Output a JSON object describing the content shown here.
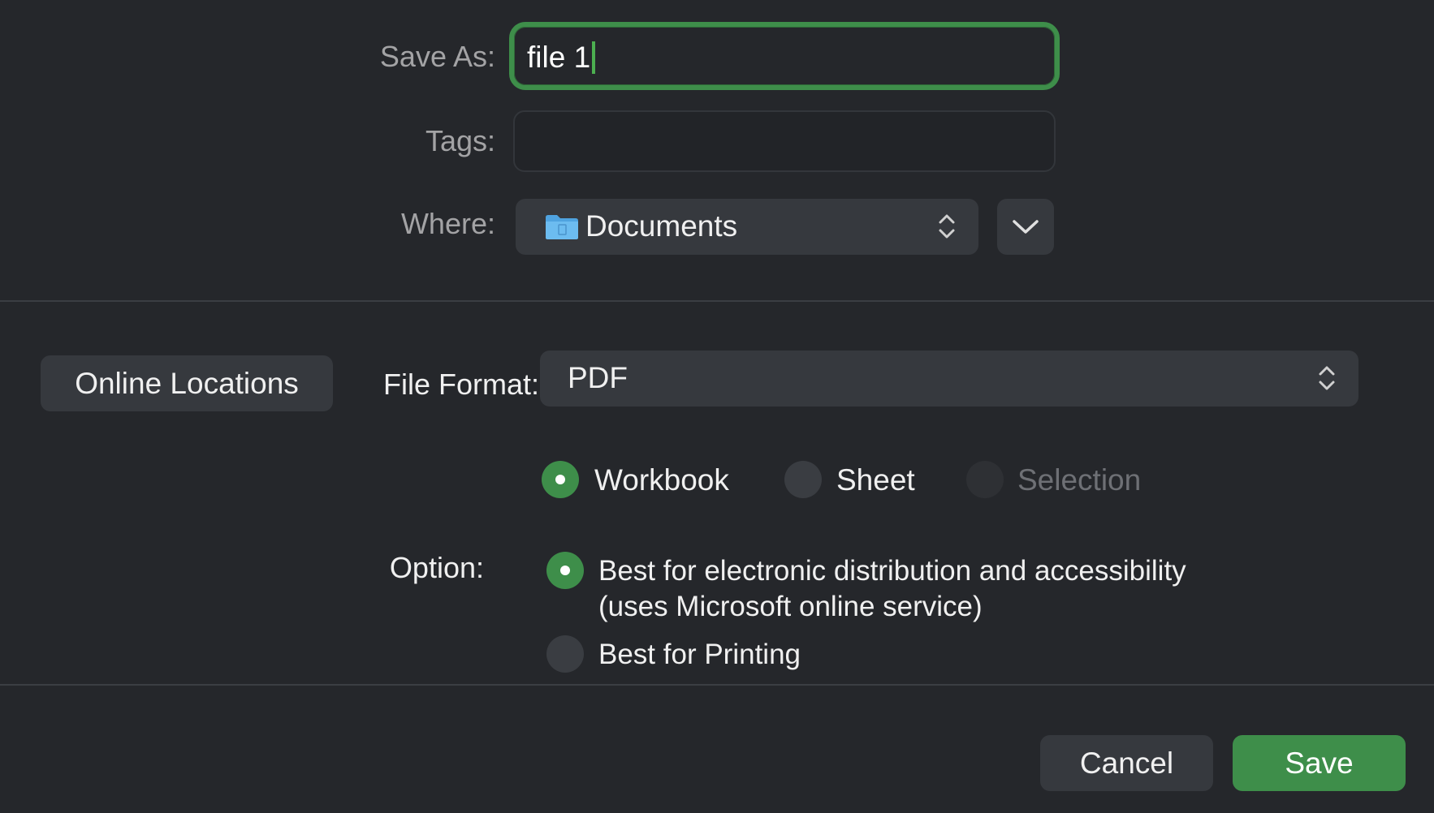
{
  "save_as": {
    "label": "Save As:",
    "value": "file 1"
  },
  "tags": {
    "label": "Tags:",
    "value": ""
  },
  "where": {
    "label": "Where:",
    "selected": "Documents",
    "folder_icon": "folder-icon"
  },
  "online_locations_label": "Online Locations",
  "file_format": {
    "label": "File Format:",
    "selected": "PDF"
  },
  "scope": {
    "options": [
      {
        "label": "Workbook",
        "selected": true,
        "enabled": true
      },
      {
        "label": "Sheet",
        "selected": false,
        "enabled": true
      },
      {
        "label": "Selection",
        "selected": false,
        "enabled": false
      }
    ]
  },
  "option": {
    "label": "Option:",
    "choices": [
      {
        "line1": "Best for electronic distribution and accessibility",
        "line2": "(uses Microsoft online service)",
        "selected": true
      },
      {
        "line1": "Best for Printing",
        "selected": false
      }
    ]
  },
  "buttons": {
    "cancel": "Cancel",
    "save": "Save"
  },
  "colors": {
    "accent": "#3e8e4a",
    "background": "#25272b",
    "control": "#36393e"
  }
}
